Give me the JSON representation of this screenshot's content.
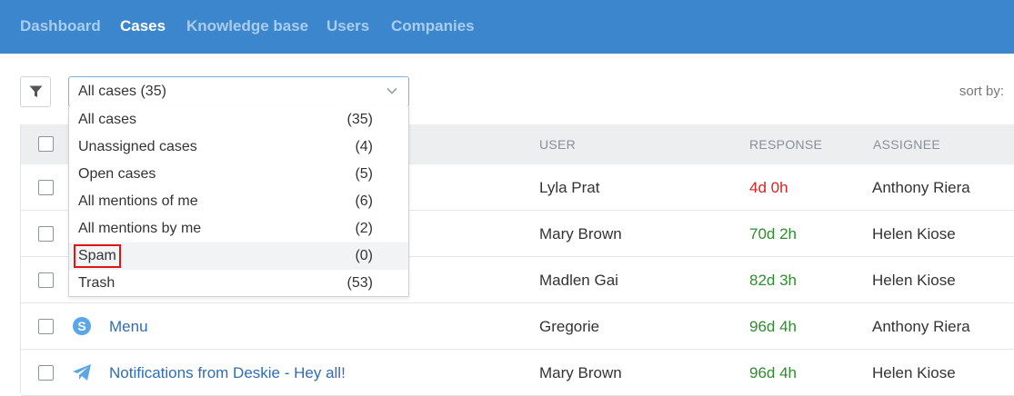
{
  "nav": {
    "items": [
      {
        "label": "Dashboard",
        "active": false
      },
      {
        "label": "Cases",
        "active": true
      },
      {
        "label": "Knowledge base",
        "active": false
      },
      {
        "label": "Users",
        "active": false
      },
      {
        "label": "Companies",
        "active": false
      }
    ]
  },
  "filter": {
    "selected": "All cases (35)",
    "icon": "filter-icon",
    "options": [
      {
        "label": "All cases",
        "count": "(35)"
      },
      {
        "label": "Unassigned cases",
        "count": "(4)"
      },
      {
        "label": "Open cases",
        "count": "(5)"
      },
      {
        "label": "All mentions of me",
        "count": "(6)"
      },
      {
        "label": "All mentions by me",
        "count": "(2)"
      },
      {
        "label": "Spam",
        "count": "(0)",
        "highlighted": true
      },
      {
        "label": "Trash",
        "count": "(53)"
      }
    ]
  },
  "sort": {
    "label": "sort by:"
  },
  "table": {
    "headers": {
      "user": "USER",
      "response": "RESPONSE",
      "assignee": "ASSIGNEE"
    },
    "rows": [
      {
        "subject": "",
        "channel": "",
        "user": "Lyla Prat",
        "response": "4d 0h",
        "response_status": "overdue",
        "assignee": "Anthony Riera"
      },
      {
        "subject": "",
        "channel": "",
        "user": "Mary Brown",
        "response": "70d 2h",
        "response_status": "ok",
        "assignee": "Helen Kiose"
      },
      {
        "subject": "",
        "channel": "",
        "user": "Madlen Gai",
        "response": "82d 3h",
        "response_status": "ok",
        "assignee": "Helen Kiose"
      },
      {
        "subject": "Menu",
        "channel": "skype-icon",
        "user": "Gregorie",
        "response": "96d 4h",
        "response_status": "ok",
        "assignee": "Anthony Riera"
      },
      {
        "subject": "Notifications from Deskie - Hey all!",
        "channel": "telegram-icon",
        "user": "Mary Brown",
        "response": "96d 4h",
        "response_status": "ok",
        "assignee": "Helen Kiose"
      }
    ]
  },
  "colors": {
    "nav_bg": "#3b86cc",
    "overdue": "#e02020",
    "ok": "#2e8b2e",
    "link": "#2f6db5",
    "highlight_box": "#e01515"
  }
}
